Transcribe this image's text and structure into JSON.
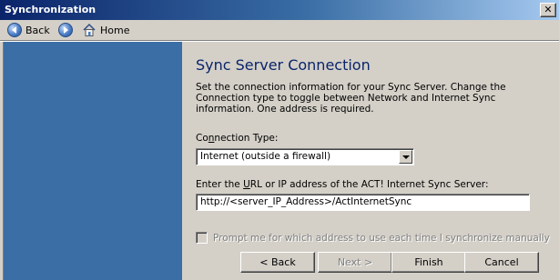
{
  "window": {
    "title": "Synchronization",
    "close_glyph": "✕"
  },
  "toolbar": {
    "back_label": "Back",
    "forward_icon": "forward-arrow-icon",
    "home_label": "Home"
  },
  "main": {
    "heading": "Sync Server Connection",
    "description": "Set the connection information for your Sync Server. Change the Connection type to toggle between Network and Internet Sync information. One address is required.",
    "connection_type_label_pre": "Co",
    "connection_type_label_u": "n",
    "connection_type_label_post": "nection Type:",
    "connection_type_value": "Internet (outside a firewall)",
    "url_label_pre": "Enter the ",
    "url_label_u": "U",
    "url_label_post": "RL or IP address of the ACT! Internet Sync Server:",
    "url_value": "http://<server_IP_Address>/ActInternetSync",
    "prompt_label": "Prompt me for which address to use each time I synchronize manually",
    "prompt_checked": false
  },
  "buttons": {
    "back": "< Back",
    "next": "Next >",
    "finish": "Finish",
    "cancel": "Cancel"
  },
  "colors": {
    "left_pane": "#3b6ea5",
    "heading": "#0a246a",
    "titlebar_start": "#0a246a"
  }
}
